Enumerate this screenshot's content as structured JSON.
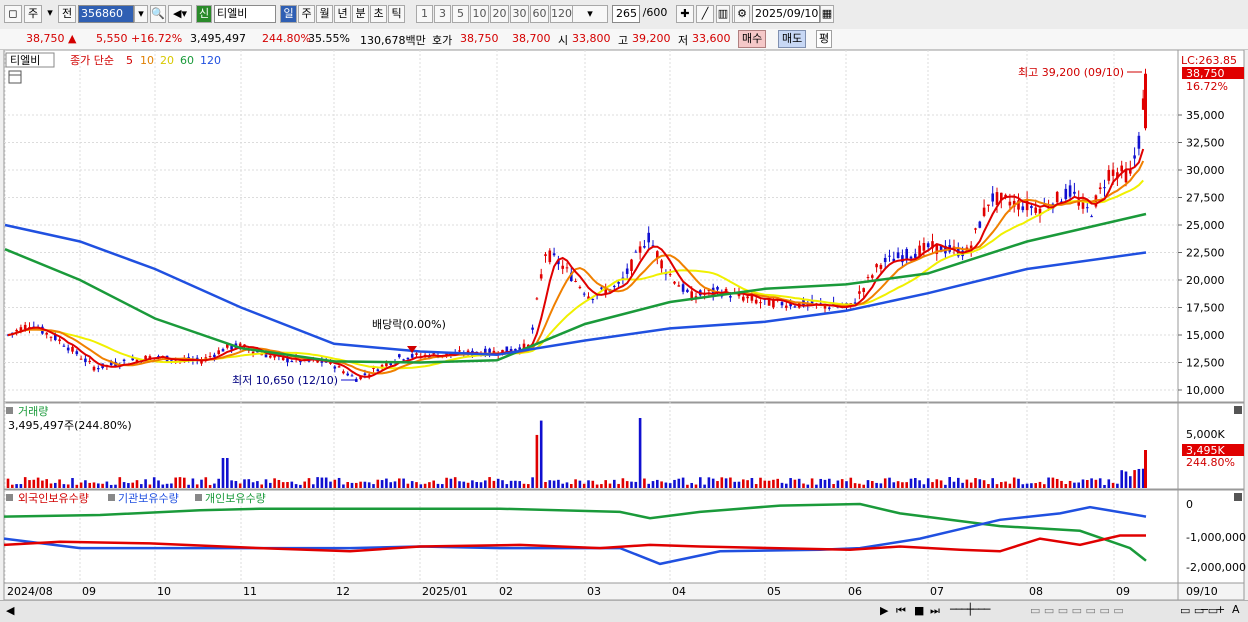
{
  "toolbar": {
    "period_a": "주",
    "period_b": "전",
    "code": "356860",
    "badge": "신",
    "name": "티엘비",
    "periods": [
      "일",
      "주",
      "월",
      "년",
      "분",
      "초",
      "틱"
    ],
    "minutes": [
      "1",
      "3",
      "5",
      "10",
      "20",
      "30",
      "60",
      "120"
    ],
    "count": "265",
    "count_total": "/600",
    "date": "2025/09/10"
  },
  "info": {
    "price": "38,750 ▲",
    "change": "5,550 +16.72%",
    "volume": "3,495,497",
    "vol_ratio": "244.80%",
    "turnover": "35.55%",
    "amount": "130,678백만",
    "quote_label": "호가",
    "ask": "38,750",
    "bid": "38,700",
    "open_label": "시",
    "open": "33,800",
    "high_label": "고",
    "high": "39,200",
    "low_label": "저",
    "low": "33,600",
    "buy": "매수",
    "sell": "매도",
    "eval": "평"
  },
  "legend": {
    "stock": "티엘비",
    "close": "종가 단순",
    "ma5": "5",
    "ma10": "10",
    "ma20": "20",
    "ma60": "60",
    "ma120": "120"
  },
  "annotations": {
    "high_note": "최고 39,200 (09/10)",
    "low_note": "최저 10,650 (12/10)",
    "dividend": "배당락(0.00%)"
  },
  "price_axis": {
    "lc": "LC:263.85",
    "current": "38,750",
    "pct": "16.72%",
    "ticks": [
      "35,000",
      "32,500",
      "30,000",
      "27,500",
      "25,000",
      "22,500",
      "20,000",
      "17,500",
      "15,000",
      "12,500",
      "10,000"
    ]
  },
  "volume_panel": {
    "title": "거래량",
    "value": "3,495,497주(244.80%)",
    "tick": "5,000K",
    "current": "3,495K",
    "pct": "244.80%"
  },
  "holdings_panel": {
    "foreign": "외국인보유수량",
    "institution": "기관보유수량",
    "individual": "개인보유수량",
    "ticks": [
      "0",
      "-1,000,000",
      "-2,000,000"
    ]
  },
  "date_axis": {
    "labels": [
      "2024/08",
      "09",
      "10",
      "11",
      "12",
      "2025/01",
      "02",
      "03",
      "04",
      "05",
      "06",
      "07",
      "08",
      "09"
    ],
    "end": "09/10"
  },
  "colors": {
    "up": "#e00000",
    "down": "#1010d0",
    "ma5": "#e00000",
    "ma10": "#f08000",
    "ma20": "#f0f000",
    "ma60": "#1a9a3a",
    "ma120": "#2050e0"
  },
  "chart_data": {
    "type": "line",
    "title": "",
    "series": [
      {
        "name": "종가",
        "x": [
          "2024/08",
          "09",
          "10",
          "11",
          "12",
          "2025/01",
          "02",
          "03",
          "04",
          "05",
          "06",
          "07",
          "08",
          "09/10"
        ],
        "values": [
          15000,
          12000,
          12800,
          13200,
          11000,
          13200,
          13500,
          22000,
          20500,
          18500,
          17800,
          22500,
          27000,
          38750
        ]
      },
      {
        "name": "120",
        "x": [
          "2024/08",
          "09",
          "10",
          "11",
          "12",
          "2025/01",
          "02",
          "03",
          "04",
          "05",
          "06",
          "07",
          "08",
          "09/10"
        ],
        "values": [
          25000,
          23500,
          21000,
          17500,
          14200,
          13500,
          13200,
          14500,
          15600,
          16200,
          17200,
          18800,
          21000,
          22500
        ]
      },
      {
        "name": "60",
        "x": [
          "2024/08",
          "09",
          "10",
          "11",
          "12",
          "2025/01",
          "02",
          "03",
          "04",
          "05",
          "06",
          "07",
          "08",
          "09/10"
        ],
        "values": [
          22800,
          20000,
          16500,
          13800,
          12600,
          12500,
          12700,
          16000,
          18000,
          19200,
          19600,
          20600,
          23500,
          26000
        ]
      }
    ],
    "ylim": [
      10000,
      35000
    ],
    "grid": true
  }
}
